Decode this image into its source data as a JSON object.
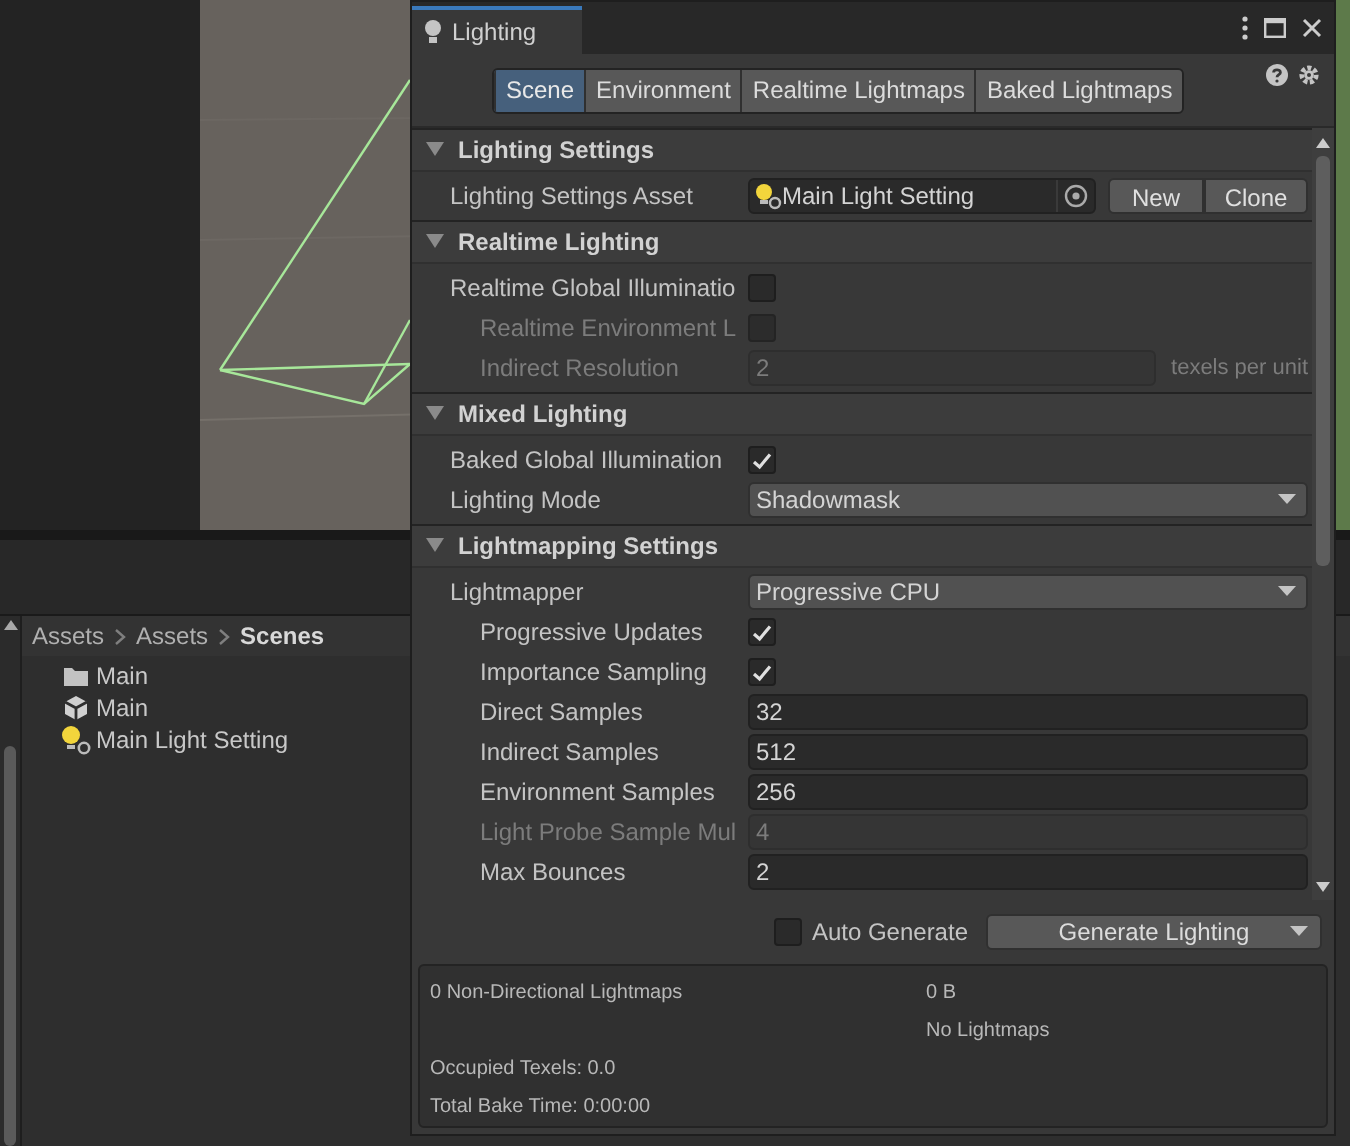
{
  "window": {
    "title": "Lighting"
  },
  "tabs": [
    {
      "label": "Scene",
      "selected": true
    },
    {
      "label": "Environment",
      "selected": false
    },
    {
      "label": "Realtime Lightmaps",
      "selected": false
    },
    {
      "label": "Baked Lightmaps",
      "selected": false
    }
  ],
  "sections": [
    {
      "title": "Lighting Settings",
      "expanded": true,
      "rows": [
        {
          "kind": "object",
          "label": "Lighting Settings Asset",
          "value": "Main Light Setting",
          "buttons": [
            "New",
            "Clone"
          ],
          "disabled": false
        }
      ]
    },
    {
      "title": "Realtime Lighting",
      "expanded": true,
      "rows": [
        {
          "kind": "checkbox",
          "label": "Realtime Global Illuminatio",
          "checked": false,
          "disabled": false,
          "children": [
            {
              "kind": "checkbox",
              "label": "Realtime Environment L",
              "checked": false,
              "disabled": true
            },
            {
              "kind": "number",
              "label": "Indirect Resolution",
              "value": "2",
              "unit": "texels per unit",
              "disabled": true
            }
          ]
        }
      ]
    },
    {
      "title": "Mixed Lighting",
      "expanded": true,
      "rows": [
        {
          "kind": "checkbox",
          "label": "Baked Global Illumination",
          "checked": true,
          "disabled": false
        },
        {
          "kind": "dropdown",
          "label": "Lighting Mode",
          "value": "Shadowmask",
          "disabled": false
        }
      ]
    },
    {
      "title": "Lightmapping Settings",
      "expanded": true,
      "rows": [
        {
          "kind": "dropdown",
          "label": "Lightmapper",
          "value": "Progressive CPU",
          "disabled": false,
          "children": [
            {
              "kind": "checkbox",
              "label": "Progressive Updates",
              "checked": true,
              "disabled": false
            },
            {
              "kind": "checkbox",
              "label": "Importance Sampling",
              "checked": true,
              "disabled": false
            },
            {
              "kind": "number",
              "label": "Direct Samples",
              "value": "32",
              "disabled": false
            },
            {
              "kind": "number",
              "label": "Indirect Samples",
              "value": "512",
              "disabled": false
            },
            {
              "kind": "number",
              "label": "Environment Samples",
              "value": "256",
              "disabled": false
            },
            {
              "kind": "number",
              "label": "Light Probe Sample Mul",
              "value": "4",
              "disabled": true
            },
            {
              "kind": "number",
              "label": "Max Bounces",
              "value": "2",
              "disabled": false
            }
          ]
        }
      ]
    }
  ],
  "auto_generate": {
    "label": "Auto Generate",
    "checked": false
  },
  "generate_button": {
    "label": "Generate Lighting"
  },
  "stats": [
    {
      "left": "0 Non-Directional Lightmaps",
      "right": "0 B"
    },
    {
      "right": "No Lightmaps"
    },
    {
      "left": "Occupied Texels: 0.0"
    },
    {
      "left": "Total Bake Time: 0:00:00"
    }
  ],
  "project": {
    "breadcrumb": [
      {
        "label": "Assets",
        "selected": false
      },
      {
        "label": "Assets",
        "selected": false
      },
      {
        "label": "Scenes",
        "selected": true
      }
    ],
    "items": [
      {
        "kind": "folder",
        "name": "Main"
      },
      {
        "kind": "scene",
        "name": "Main"
      },
      {
        "kind": "lighting",
        "name": "Main Light Setting"
      }
    ]
  }
}
